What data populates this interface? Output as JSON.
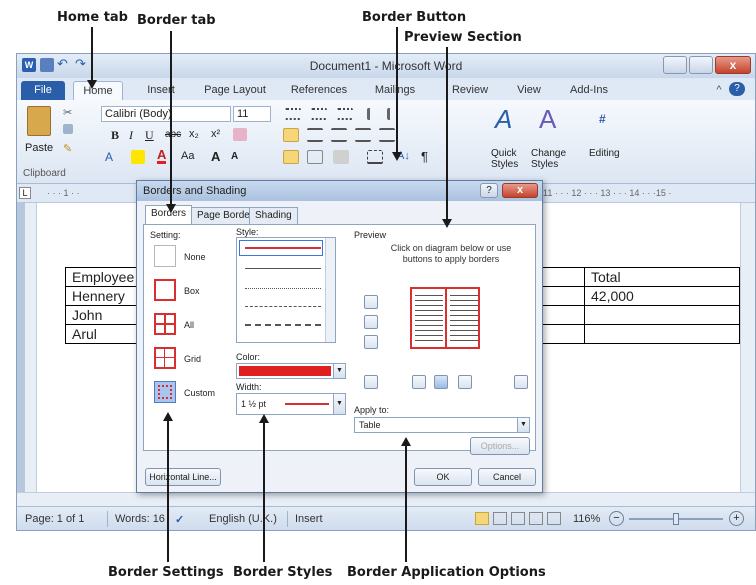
{
  "callouts": {
    "home_tab": "Home tab",
    "border_tab": "Border tab",
    "border_button": "Border Button",
    "preview_section": "Preview Section",
    "border_settings": "Border Settings",
    "border_styles": "Border Styles",
    "border_application_options": "Border Application Options"
  },
  "window": {
    "title": "Document1 - Microsoft Word",
    "close_glyph": "x"
  },
  "tabs": {
    "file": "File",
    "home": "Home",
    "insert": "Insert",
    "page_layout": "Page Layout",
    "references": "References",
    "mailings": "Mailings",
    "review": "Review",
    "view": "View",
    "addins": "Add-Ins"
  },
  "ribbon": {
    "font_name": "Calibri (Body)",
    "font_size": "11",
    "paste": "Paste",
    "clipboard": "Clipboard",
    "bold": "B",
    "italic": "I",
    "underline": "U",
    "strike": "abc",
    "subscript": "x₂",
    "superscript": "x²",
    "change_case": "Aa",
    "grow_font": "A",
    "shrink_font": "A",
    "quick_styles": "Quick Styles",
    "change_styles": "Change Styles",
    "editing": "Editing",
    "pilcrow": "¶",
    "sort": "A↓"
  },
  "ruler": {
    "left_ticks": "· · · 1 · ·",
    "right_ticks": "11 · · · 12 · · · 13 · · · 14 · · ·15 · "
  },
  "document_table": {
    "rows": [
      [
        "Employee",
        "Total"
      ],
      [
        "Hennery",
        "42,000"
      ],
      [
        "John",
        ""
      ],
      [
        "Arul",
        ""
      ]
    ]
  },
  "dialog": {
    "title": "Borders and Shading",
    "help": "?",
    "close": "x",
    "tabs": [
      "Borders",
      "Page Border",
      "Shading"
    ],
    "setting_label": "Setting:",
    "settings": [
      "None",
      "Box",
      "All",
      "Grid",
      "Custom"
    ],
    "style_label": "Style:",
    "color_label": "Color:",
    "width_label": "Width:",
    "width_value": "1 ½ pt",
    "preview_label": "Preview",
    "preview_hint": "Click on diagram below or use buttons to apply borders",
    "apply_to_label": "Apply to:",
    "apply_to_value": "Table",
    "options": "Options...",
    "horizontal_line": "Horizontal Line...",
    "ok": "OK",
    "cancel": "Cancel",
    "border_color": "#e02020"
  },
  "status": {
    "page": "Page: 1 of 1",
    "words": "Words: 16",
    "language": "English (U.K.)",
    "mode": "Insert",
    "zoom": "116%",
    "zoom_out": "−",
    "zoom_in": "+"
  }
}
